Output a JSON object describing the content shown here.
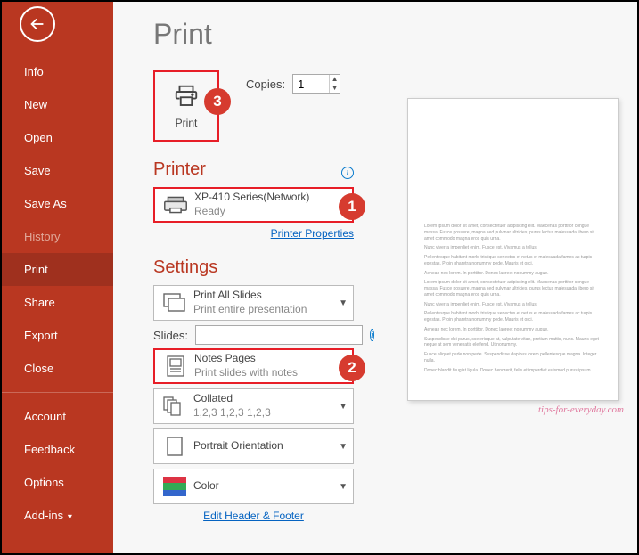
{
  "sidebar": {
    "items": [
      {
        "label": "Info"
      },
      {
        "label": "New"
      },
      {
        "label": "Open"
      },
      {
        "label": "Save"
      },
      {
        "label": "Save As"
      },
      {
        "label": "History"
      },
      {
        "label": "Print"
      },
      {
        "label": "Share"
      },
      {
        "label": "Export"
      },
      {
        "label": "Close"
      },
      {
        "label": "Account"
      },
      {
        "label": "Feedback"
      },
      {
        "label": "Options"
      },
      {
        "label": "Add-ins"
      }
    ]
  },
  "page": {
    "title": "Print"
  },
  "print_button": {
    "label": "Print"
  },
  "copies": {
    "label": "Copies:",
    "value": "1"
  },
  "printer": {
    "heading": "Printer",
    "name": "XP-410 Series(Network)",
    "status": "Ready",
    "properties_link": "Printer Properties"
  },
  "settings": {
    "heading": "Settings",
    "print_what": {
      "title": "Print All Slides",
      "sub": "Print entire presentation"
    },
    "slides_label": "Slides:",
    "slides_value": "",
    "layout": {
      "title": "Notes Pages",
      "sub": "Print slides with notes"
    },
    "collate": {
      "title": "Collated",
      "sub": "1,2,3   1,2,3   1,2,3"
    },
    "orientation": {
      "title": "Portrait Orientation"
    },
    "color": {
      "title": "Color"
    },
    "footer_link": "Edit Header & Footer"
  },
  "callouts": {
    "one": "1",
    "two": "2",
    "three": "3"
  },
  "colors": {
    "brand": "#b93721",
    "link": "#0563c1",
    "red_box": "#e71e27"
  },
  "watermark": "tips-for-everyday.com",
  "preview_text": [
    "Lorem ipsum dolor sit amet, consectetuer adipiscing elit. Maecenas porttitor congue massa. Fusce posuere, magna sed pulvinar ultricies, purus lectus malesuada libero sit amet commodo magna eros quis urna.",
    "Nunc viverra imperdiet enim. Fusce est. Vivamus a tellus.",
    "Pellentesque habitant morbi tristique senectus et netus et malesuada fames ac turpis egestas. Proin pharetra nonummy pede. Mauris et orci.",
    "Aenean nec lorem. In porttitor. Donec laoreet nonummy augue.",
    "Lorem ipsum dolor sit amet, consectetuer adipiscing elit. Maecenas porttitor congue massa. Fusce posuere, magna sed pulvinar ultricies, purus lectus malesuada libero sit amet commodo magna eros quis urna.",
    "Nunc viverra imperdiet enim. Fusce est. Vivamus a tellus.",
    "Pellentesque habitant morbi tristique senectus et netus et malesuada fames ac turpis egestas. Proin pharetra nonummy pede. Mauris et orci.",
    "Aenean nec lorem. In porttitor. Donec laoreet nonummy augue.",
    "Suspendisse dui purus, scelerisque at, vulputate vitae, pretium mattis, nunc. Mauris eget neque at sem venenatis eleifend. Ut nonummy.",
    "Fusce aliquet pede non pede. Suspendisse dapibus lorem pellentesque magna. Integer nulla.",
    "Donec blandit feugiat ligula. Donec hendrerit, felis et imperdiet euismod purus ipsum"
  ]
}
